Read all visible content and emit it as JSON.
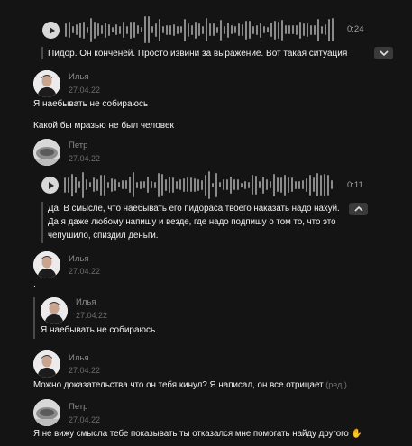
{
  "voice1": {
    "duration": "0:24",
    "transcript": "Пидор. Он конченей. Просто извини за выражение. Вот такая ситуация"
  },
  "m1": {
    "author": "Илья",
    "date": "27.04.22",
    "lines": [
      "Я наебывать не собираюсь",
      "Какой бы мразью не был человек"
    ]
  },
  "m2": {
    "author": "Петр",
    "date": "27.04.22",
    "voice": {
      "duration": "0:11",
      "transcript": [
        "Да. В смысле, что наебывать его пидораса твоего наказать надо нахуй.",
        "Да я даже любому напишу и везде, где надо подпишу о том то, что это",
        "чепушило, спиздил деньги."
      ]
    }
  },
  "m3": {
    "author": "Илья",
    "date": "27.04.22",
    "text": "."
  },
  "quote": {
    "author": "Илья",
    "date": "27.04.22",
    "text": "Я наебывать не собираюсь"
  },
  "m4": {
    "author": "Илья",
    "date": "27.04.22",
    "text": "Можно доказательства что он тебя кинул? Я написал, он все отрицает",
    "edited": "(ред.)"
  },
  "m5": {
    "author": "Петр",
    "date": "27.04.22",
    "text": "Я не вижу смысла тебе показывать ты отказался мне помогать найду другого",
    "emoji": "✋"
  },
  "icons": {
    "play": "play-icon",
    "collapse": "chevron-down-icon",
    "expand": "chevron-up-icon",
    "wave": "waveform-icon"
  }
}
